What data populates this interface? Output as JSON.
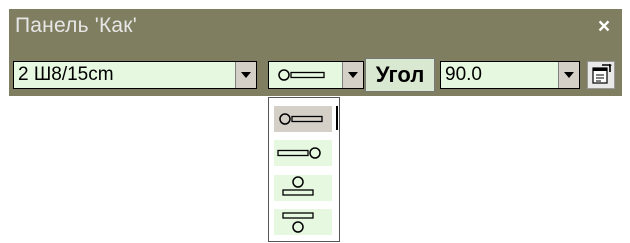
{
  "window": {
    "title": "Панель 'Как'",
    "close_label": "×"
  },
  "toolbar": {
    "size_combo_value": "2 Ш8/15cm",
    "angle_label": "Угол",
    "angle_combo_value": "90.0"
  },
  "colors": {
    "titlebar_bg": "#7f7e60",
    "combo_bg": "#e6f8df",
    "selected_option_bg": "#d4d0c8"
  },
  "symbol_options": [
    {
      "icon": "circle-left-bar-right-icon",
      "selected": true
    },
    {
      "icon": "bar-left-circle-right-icon",
      "selected": false
    },
    {
      "icon": "circle-above-bar-icon",
      "selected": false
    },
    {
      "icon": "circle-below-bar-icon",
      "selected": false
    }
  ]
}
